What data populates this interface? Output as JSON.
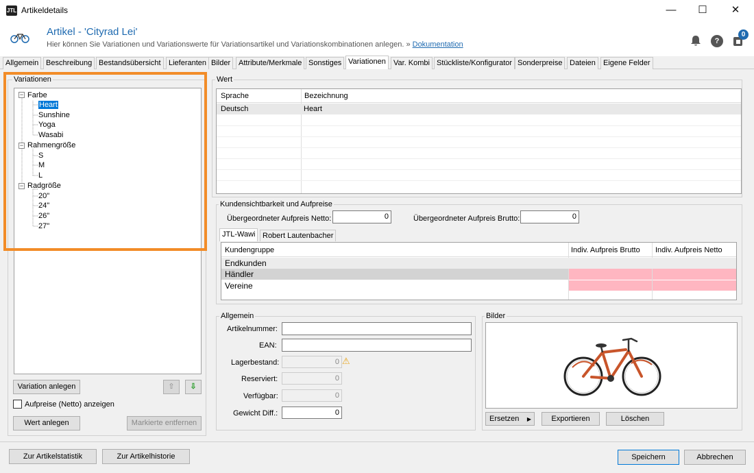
{
  "window": {
    "title": "Artikeldetails",
    "minimize": "—",
    "maximize": "☐",
    "close": "✕"
  },
  "header": {
    "title": "Artikel - 'Cityrad Lei'",
    "subtitle": "Hier können Sie Variationen und Variationswerte für Variationsartikel und Variationskombinationen anlegen. »",
    "doc_link": "Dokumentation",
    "badge": "0",
    "logo": "JTL"
  },
  "tabs": [
    "Allgemein",
    "Beschreibung",
    "Bestandsübersicht",
    "Lieferanten",
    "Bilder",
    "Attribute/Merkmale",
    "Sonstiges",
    "Variationen",
    "Var. Kombi",
    "Stückliste/Konfigurator",
    "Sonderpreise",
    "Dateien",
    "Eigene Felder"
  ],
  "variationen": {
    "label": "Variationen",
    "groups": [
      {
        "name": "Farbe",
        "values": [
          "Heart",
          "Sunshine",
          "Yoga",
          "Wasabi"
        ]
      },
      {
        "name": "Rahmengröße",
        "values": [
          "S",
          "M",
          "L"
        ]
      },
      {
        "name": "Radgröße",
        "values": [
          "20\"",
          "24\"",
          "26\"",
          "27\""
        ]
      }
    ],
    "add_variation": "Variation anlegen",
    "show_prices": "Aufpreise (Netto) anzeigen",
    "add_value": "Wert anlegen",
    "remove_marked": "Markierte entfernen",
    "up": "⇧",
    "down": "⇩"
  },
  "wert": {
    "label": "Wert",
    "col_lang": "Sprache",
    "col_name": "Bezeichnung",
    "row_lang": "Deutsch",
    "row_name": "Heart"
  },
  "kunden": {
    "label": "Kundensichtbarkeit und Aufpreise",
    "netto_label": "Übergeordneter Aufpreis Netto:",
    "netto": "0",
    "brutto_label": "Übergeordneter Aufpreis Brutto:",
    "brutto": "0",
    "tabs": [
      "JTL-Wawi",
      "Robert Lautenbacher"
    ],
    "col_group": "Kundengruppe",
    "col_brutto": "Indiv. Aufpreis Brutto",
    "col_netto": "Indiv. Aufpreis Netto",
    "rows": [
      "Endkunden",
      "Händler",
      "Vereine"
    ]
  },
  "allgemein": {
    "label": "Allgemein",
    "artnr_label": "Artikelnummer:",
    "ean_label": "EAN:",
    "lager_label": "Lagerbestand:",
    "lager": "0",
    "reserv_label": "Reserviert:",
    "reserv": "0",
    "verf_label": "Verfügbar:",
    "verf": "0",
    "gewicht_label": "Gewicht Diff.:",
    "gewicht": "0",
    "warning": "⚠"
  },
  "bilder": {
    "label": "Bilder",
    "replace": "Ersetzen",
    "export": "Exportieren",
    "delete": "Löschen"
  },
  "footer": {
    "stats": "Zur Artikelstatistik",
    "history": "Zur Artikelhistorie",
    "save": "Speichern",
    "cancel": "Abbrechen"
  },
  "colors": {
    "accent": "#1e6ab0",
    "highlight": "#f28c28",
    "pink": "#ffb6c1",
    "select": "#0078d7"
  }
}
